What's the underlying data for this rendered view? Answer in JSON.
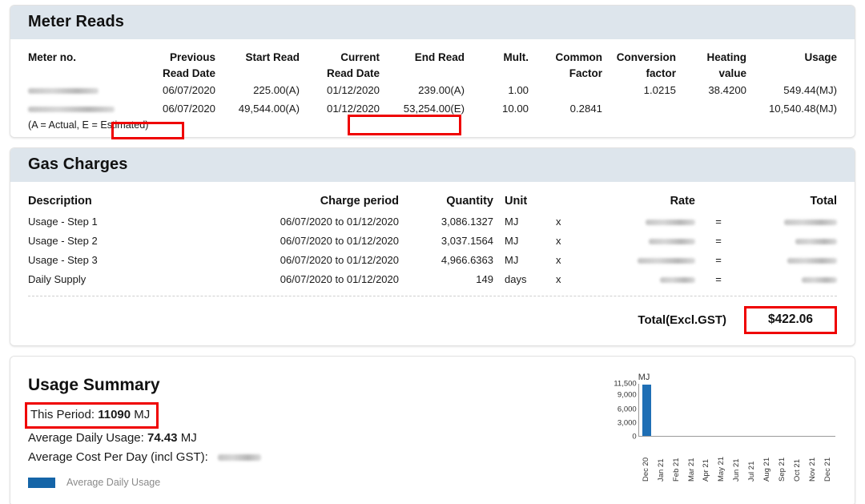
{
  "meter_reads": {
    "title": "Meter Reads",
    "columns": [
      "Meter no.",
      "Previous Read Date",
      "Start Read",
      "Current Read Date",
      "End Read",
      "Mult.",
      "Common Factor",
      "Conversion factor",
      "Heating value",
      "Usage"
    ],
    "columns_split": [
      {
        "l1": "Meter no.",
        "l2": ""
      },
      {
        "l1": "Previous",
        "l2": "Read Date"
      },
      {
        "l1": "Start Read",
        "l2": ""
      },
      {
        "l1": "Current",
        "l2": "Read Date"
      },
      {
        "l1": "End Read",
        "l2": ""
      },
      {
        "l1": "Mult.",
        "l2": ""
      },
      {
        "l1": "Common",
        "l2": "Factor"
      },
      {
        "l1": "Conversion",
        "l2": "factor"
      },
      {
        "l1": "Heating",
        "l2": "value"
      },
      {
        "l1": "Usage",
        "l2": ""
      }
    ],
    "rows": [
      {
        "meter_no": "",
        "previous_read_date": "06/07/2020",
        "start_read": "225.00(A)",
        "current_read_date": "01/12/2020",
        "end_read": "239.00(A)",
        "mult": "1.00",
        "common_factor": "",
        "conversion_factor": "1.0215",
        "heating_value": "38.4200",
        "usage": "549.44(MJ)"
      },
      {
        "meter_no": "",
        "previous_read_date": "06/07/2020",
        "start_read": "49,544.00(A)",
        "current_read_date": "01/12/2020",
        "end_read": "53,254.00(E)",
        "mult": "10.00",
        "common_factor": "0.2841",
        "conversion_factor": "",
        "heating_value": "",
        "usage": "10,540.48(MJ)"
      }
    ],
    "footnote_prefix": "(A = Actual, E = ",
    "footnote_highlight": "Estimated)"
  },
  "gas_charges": {
    "title": "Gas Charges",
    "columns": {
      "description": "Description",
      "charge_period": "Charge period",
      "quantity": "Quantity",
      "unit": "Unit",
      "rate": "Rate",
      "total": "Total"
    },
    "rows": [
      {
        "description": "Usage - Step 1",
        "charge_period": "06/07/2020 to 01/12/2020",
        "quantity": "3,086.1327",
        "unit": "MJ",
        "operator": "x",
        "rate": "",
        "equals": "=",
        "total": ""
      },
      {
        "description": "Usage - Step 2",
        "charge_period": "06/07/2020 to 01/12/2020",
        "quantity": "3,037.1564",
        "unit": "MJ",
        "operator": "x",
        "rate": "",
        "equals": "=",
        "total": ""
      },
      {
        "description": "Usage - Step 3",
        "charge_period": "06/07/2020 to 01/12/2020",
        "quantity": "4,966.6363",
        "unit": "MJ",
        "operator": "x",
        "rate": "",
        "equals": "=",
        "total": ""
      },
      {
        "description": "Daily Supply",
        "charge_period": "06/07/2020 to 01/12/2020",
        "quantity": "149",
        "unit": "days",
        "operator": "x",
        "rate": "",
        "equals": "=",
        "total": ""
      }
    ],
    "total_label": "Total(Excl.GST)",
    "total_value": "$422.06"
  },
  "usage_summary": {
    "title": "Usage Summary",
    "this_period_label": "This Period:",
    "this_period_value": "11090",
    "this_period_unit": "MJ",
    "avg_daily_label": "Average Daily Usage:",
    "avg_daily_value": "74.43",
    "avg_daily_unit": "MJ",
    "avg_cost_label": "Average Cost Per Day (incl GST):",
    "avg_cost_value": "",
    "legend_label": "Average Daily Usage"
  },
  "chart_data": {
    "type": "bar",
    "title": "",
    "unit_label": "MJ",
    "xlabel": "",
    "ylabel": "MJ",
    "categories": [
      "Dec 20",
      "Jan 21",
      "Feb 21",
      "Mar 21",
      "Apr 21",
      "May 21",
      "Jun 21",
      "Jul 21",
      "Aug 21",
      "Sep 21",
      "Oct 21",
      "Nov 21",
      "Dec 21"
    ],
    "values": [
      11090,
      0,
      0,
      0,
      0,
      0,
      0,
      0,
      0,
      0,
      0,
      0,
      0
    ],
    "series": [
      {
        "name": "Average Daily Usage",
        "values": [
          11090,
          0,
          0,
          0,
          0,
          0,
          0,
          0,
          0,
          0,
          0,
          0,
          0
        ]
      }
    ],
    "ytick_labels": [
      "11,500",
      "9,000",
      "6,000",
      "3,000",
      "0"
    ],
    "yticks": [
      11500,
      9000,
      6000,
      3000,
      0
    ],
    "ylim": [
      0,
      11500
    ],
    "grid": false,
    "legend_position": "below-left",
    "bar_color": "#1f6fb5"
  },
  "colors": {
    "header_band": "#dde5ec",
    "annotation": "#ef0000",
    "bar": "#1f6fb5",
    "legend_swatch": "#1565a8"
  }
}
